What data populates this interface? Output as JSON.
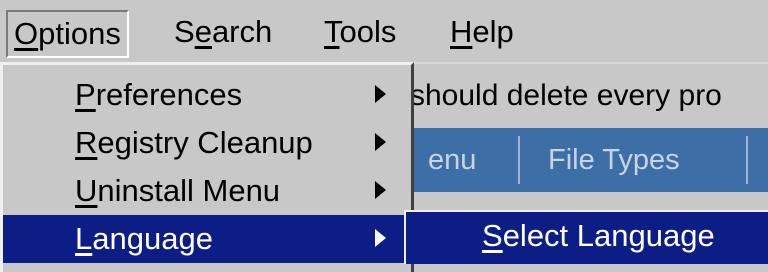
{
  "menubar": {
    "items": [
      {
        "key": "O",
        "rest": "ptions",
        "open": true
      },
      {
        "pre": "S",
        "key": "e",
        "rest": "arch"
      },
      {
        "key": "T",
        "rest": "ools"
      },
      {
        "key": "H",
        "rest": "elp"
      }
    ]
  },
  "background": {
    "hint_text": "should delete every pro",
    "tabs": [
      "enu",
      "File Types"
    ]
  },
  "options_menu": {
    "items": [
      {
        "key": "P",
        "rest": "references",
        "has_submenu": true
      },
      {
        "key": "R",
        "rest": "egistry Cleanup",
        "has_submenu": true
      },
      {
        "key": "U",
        "rest": "ninstall Menu",
        "has_submenu": true
      },
      {
        "key": "L",
        "rest": "anguage",
        "has_submenu": true,
        "selected": true
      }
    ]
  },
  "language_submenu": {
    "items": [
      {
        "key": "S",
        "rest": "elect Language",
        "selected": true
      }
    ]
  },
  "colors": {
    "menu_background": "#c8c8c8",
    "highlight": "#0c1d86",
    "tab_strip": "#3d6ea6"
  }
}
